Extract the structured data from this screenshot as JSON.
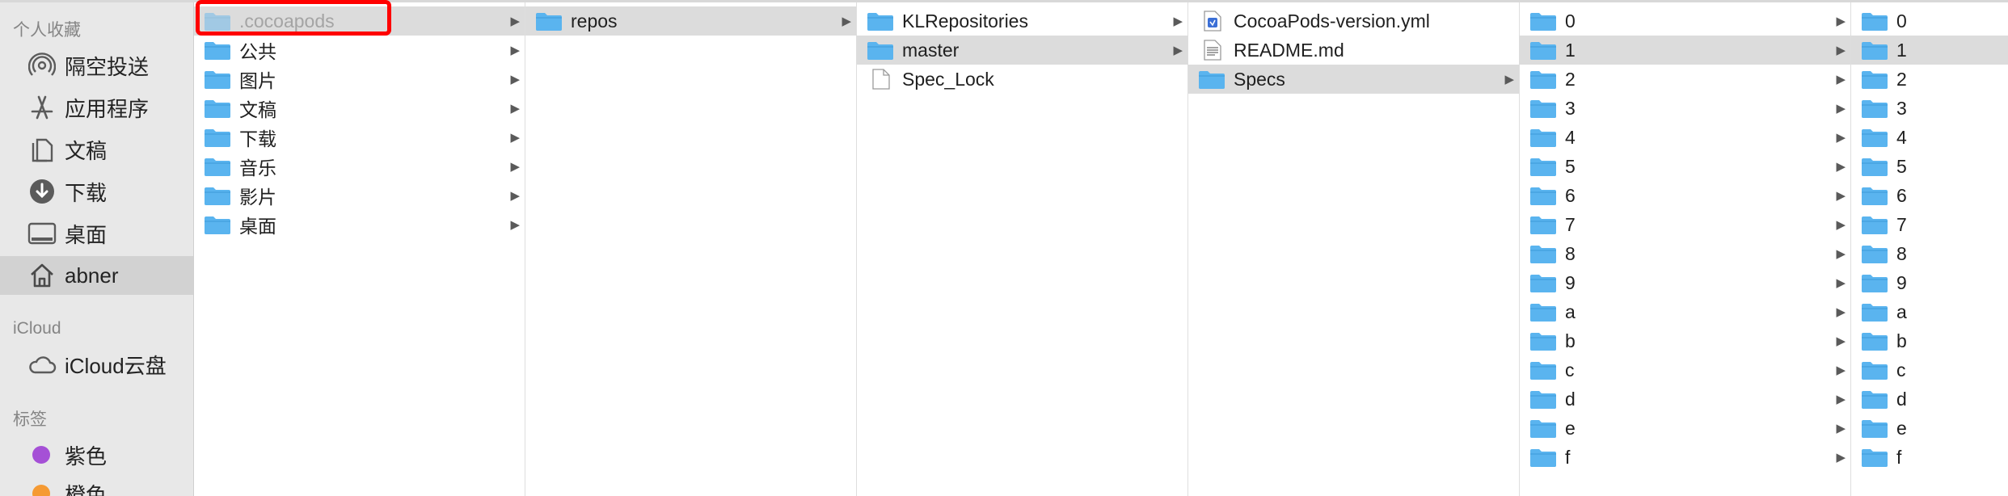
{
  "sidebar": {
    "favorites_header": "个人收藏",
    "favorites": [
      {
        "label": "隔空投送",
        "icon": "airdrop-icon"
      },
      {
        "label": "应用程序",
        "icon": "applications-icon"
      },
      {
        "label": "文稿",
        "icon": "documents-icon"
      },
      {
        "label": "下载",
        "icon": "downloads-icon"
      },
      {
        "label": "桌面",
        "icon": "desktop-icon"
      },
      {
        "label": "abner",
        "icon": "home-icon",
        "selected": true
      }
    ],
    "icloud_header": "iCloud",
    "icloud": [
      {
        "label": "iCloud云盘",
        "icon": "cloud-icon"
      }
    ],
    "tags_header": "标签",
    "tags": [
      {
        "label": "紫色",
        "color": "#a550d6"
      },
      {
        "label": "橙色",
        "color": "#f59a33"
      }
    ]
  },
  "columns": [
    {
      "items": [
        {
          "label": ".cocoapods",
          "type": "folder",
          "selected": true,
          "hidden": true,
          "chevron": true
        },
        {
          "label": "公共",
          "type": "folder",
          "chevron": true
        },
        {
          "label": "图片",
          "type": "folder",
          "chevron": true
        },
        {
          "label": "文稿",
          "type": "folder",
          "chevron": true
        },
        {
          "label": "下载",
          "type": "folder",
          "chevron": true
        },
        {
          "label": "音乐",
          "type": "folder",
          "chevron": true
        },
        {
          "label": "影片",
          "type": "folder",
          "chevron": true
        },
        {
          "label": "桌面",
          "type": "folder",
          "chevron": true
        }
      ]
    },
    {
      "items": [
        {
          "label": "repos",
          "type": "folder",
          "selected": true,
          "chevron": true
        }
      ]
    },
    {
      "items": [
        {
          "label": "KLRepositories",
          "type": "folder",
          "chevron": true
        },
        {
          "label": "master",
          "type": "folder",
          "selected": true,
          "chevron": true
        },
        {
          "label": "Spec_Lock",
          "type": "file",
          "chevron": false
        }
      ]
    },
    {
      "items": [
        {
          "label": "CocoaPods-version.yml",
          "type": "yml",
          "chevron": false
        },
        {
          "label": "README.md",
          "type": "text",
          "chevron": false
        },
        {
          "label": "Specs",
          "type": "folder",
          "selected": true,
          "chevron": true
        }
      ]
    },
    {
      "items": [
        {
          "label": "0",
          "type": "folder",
          "chevron": true
        },
        {
          "label": "1",
          "type": "folder",
          "selected": true,
          "chevron": true
        },
        {
          "label": "2",
          "type": "folder",
          "chevron": true
        },
        {
          "label": "3",
          "type": "folder",
          "chevron": true
        },
        {
          "label": "4",
          "type": "folder",
          "chevron": true
        },
        {
          "label": "5",
          "type": "folder",
          "chevron": true
        },
        {
          "label": "6",
          "type": "folder",
          "chevron": true
        },
        {
          "label": "7",
          "type": "folder",
          "chevron": true
        },
        {
          "label": "8",
          "type": "folder",
          "chevron": true
        },
        {
          "label": "9",
          "type": "folder",
          "chevron": true
        },
        {
          "label": "a",
          "type": "folder",
          "chevron": true
        },
        {
          "label": "b",
          "type": "folder",
          "chevron": true
        },
        {
          "label": "c",
          "type": "folder",
          "chevron": true
        },
        {
          "label": "d",
          "type": "folder",
          "chevron": true
        },
        {
          "label": "e",
          "type": "folder",
          "chevron": true
        },
        {
          "label": "f",
          "type": "folder",
          "chevron": true
        }
      ]
    },
    {
      "items": [
        {
          "label": "0",
          "type": "folder",
          "chevron": false
        },
        {
          "label": "1",
          "type": "folder",
          "selected": true,
          "chevron": false
        },
        {
          "label": "2",
          "type": "folder",
          "chevron": false
        },
        {
          "label": "3",
          "type": "folder",
          "chevron": false
        },
        {
          "label": "4",
          "type": "folder",
          "chevron": false
        },
        {
          "label": "5",
          "type": "folder",
          "chevron": false
        },
        {
          "label": "6",
          "type": "folder",
          "chevron": false
        },
        {
          "label": "7",
          "type": "folder",
          "chevron": false
        },
        {
          "label": "8",
          "type": "folder",
          "chevron": false
        },
        {
          "label": "9",
          "type": "folder",
          "chevron": false
        },
        {
          "label": "a",
          "type": "folder",
          "chevron": false
        },
        {
          "label": "b",
          "type": "folder",
          "chevron": false
        },
        {
          "label": "c",
          "type": "folder",
          "chevron": false
        },
        {
          "label": "d",
          "type": "folder",
          "chevron": false
        },
        {
          "label": "e",
          "type": "folder",
          "chevron": false
        },
        {
          "label": "f",
          "type": "folder",
          "chevron": false
        }
      ]
    }
  ],
  "chevron_glyph": "▶",
  "colors": {
    "folder": "#5ab4ef",
    "highlight": "#ff0000",
    "selection": "#dcdcdc"
  }
}
